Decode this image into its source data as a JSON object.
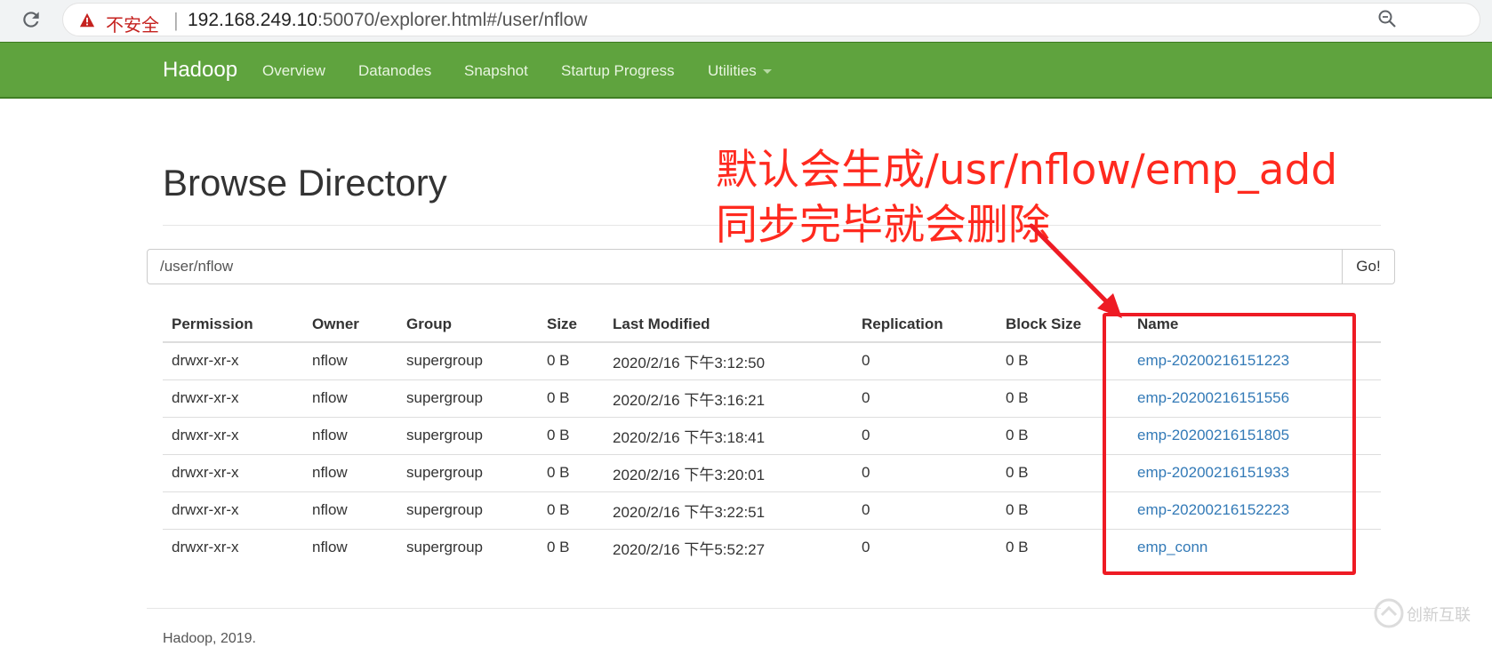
{
  "browser": {
    "security_label": "不安全",
    "separator": "|",
    "url_host": "192.168.249.10",
    "url_rest": ":50070/explorer.html#/user/nflow"
  },
  "navbar": {
    "brand": "Hadoop",
    "items": [
      "Overview",
      "Datanodes",
      "Snapshot",
      "Startup Progress",
      "Utilities"
    ],
    "color": "#5fa33e"
  },
  "page": {
    "title": "Browse Directory",
    "path_value": "/user/nflow",
    "go_label": "Go!"
  },
  "table": {
    "headers": [
      "Permission",
      "Owner",
      "Group",
      "Size",
      "Last Modified",
      "Replication",
      "Block Size",
      "Name"
    ],
    "rows": [
      [
        "drwxr-xr-x",
        "nflow",
        "supergroup",
        "0 B",
        "2020/2/16 下午3:12:50",
        "0",
        "0 B",
        "emp-20200216151223"
      ],
      [
        "drwxr-xr-x",
        "nflow",
        "supergroup",
        "0 B",
        "2020/2/16 下午3:16:21",
        "0",
        "0 B",
        "emp-20200216151556"
      ],
      [
        "drwxr-xr-x",
        "nflow",
        "supergroup",
        "0 B",
        "2020/2/16 下午3:18:41",
        "0",
        "0 B",
        "emp-20200216151805"
      ],
      [
        "drwxr-xr-x",
        "nflow",
        "supergroup",
        "0 B",
        "2020/2/16 下午3:20:01",
        "0",
        "0 B",
        "emp-20200216151933"
      ],
      [
        "drwxr-xr-x",
        "nflow",
        "supergroup",
        "0 B",
        "2020/2/16 下午3:22:51",
        "0",
        "0 B",
        "emp-20200216152223"
      ],
      [
        "drwxr-xr-x",
        "nflow",
        "supergroup",
        "0 B",
        "2020/2/16 下午5:52:27",
        "0",
        "0 B",
        "emp_conn"
      ]
    ],
    "link_color": "#337ab7"
  },
  "footer": {
    "text": "Hadoop, 2019."
  },
  "annotation": {
    "line1": "默认会生成/usr/nflow/emp_add",
    "line2": "同步完毕就会删除",
    "color": "#ff2a1f"
  },
  "watermark": {
    "text": "创新互联"
  },
  "icons": {
    "reload": "reload-icon",
    "warning": "warning-icon",
    "zoom": "zoom-icon",
    "caret": "caret-down-icon"
  }
}
